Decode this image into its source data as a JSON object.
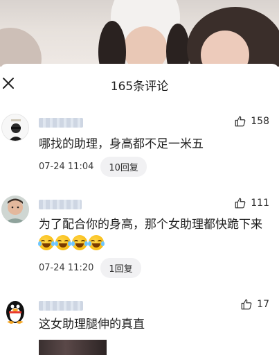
{
  "sheet": {
    "title": "165条评论"
  },
  "comments": [
    {
      "text": "哪找的助理，身高都不足一米五",
      "time": "07-24 11:04",
      "reply_label": "10回复",
      "likes": "158"
    },
    {
      "text": "为了配合你的身高，那个女助理都快跪下来",
      "emoji_count": 4,
      "time": "07-24 11:20",
      "reply_label": "1回复",
      "likes": "111"
    },
    {
      "text": "这女助理腿伸的真直",
      "likes": "17"
    }
  ],
  "icons": {
    "close": "close-icon",
    "like": "thumbs-up-icon"
  }
}
